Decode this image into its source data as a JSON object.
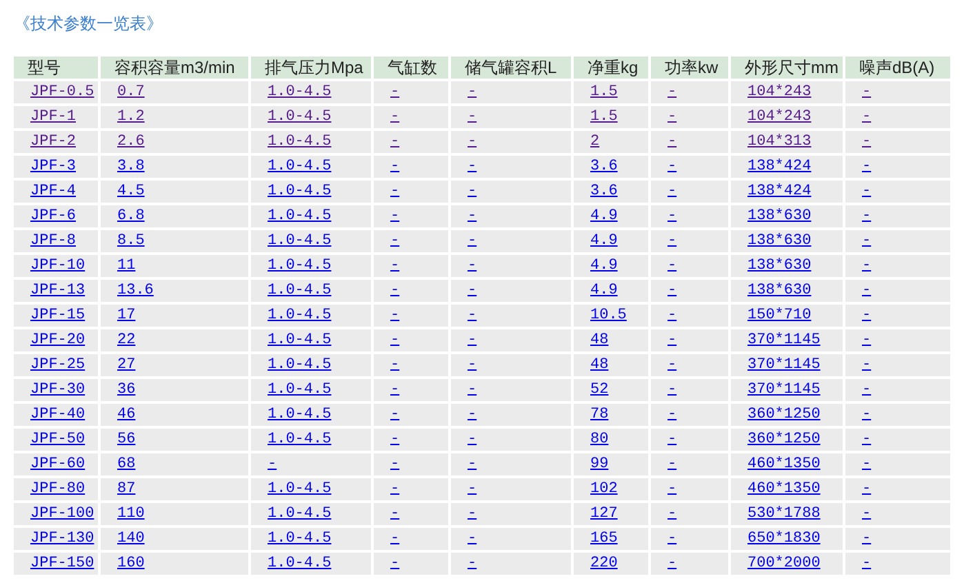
{
  "title": "《技术参数一览表》",
  "table": {
    "columns": [
      "型号",
      "容积容量m3/min",
      "排气压力Mpa",
      "气缸数",
      "储气罐容积L",
      "净重kg",
      "功率kw",
      "外形尺寸mm",
      "噪声dB(A)"
    ],
    "rows": [
      {
        "visited": true,
        "cells": [
          "JPF-0.5",
          "0.7",
          "1.0-4.5",
          "-",
          "-",
          "1.5",
          "-",
          "104*243",
          "-"
        ]
      },
      {
        "visited": true,
        "cells": [
          "JPF-1",
          "1.2",
          "1.0-4.5",
          "-",
          "-",
          "1.5",
          "-",
          "104*243",
          "-"
        ]
      },
      {
        "visited": true,
        "cells": [
          "JPF-2",
          "2.6",
          "1.0-4.5",
          "-",
          "-",
          "2",
          "-",
          "104*313",
          "-"
        ]
      },
      {
        "visited": false,
        "cells": [
          "JPF-3",
          "3.8",
          "1.0-4.5",
          "-",
          "-",
          "3.6",
          "-",
          "138*424",
          "-"
        ]
      },
      {
        "visited": false,
        "cells": [
          "JPF-4",
          "4.5",
          "1.0-4.5",
          "-",
          "-",
          "3.6",
          "-",
          "138*424",
          "-"
        ]
      },
      {
        "visited": false,
        "cells": [
          "JPF-6",
          "6.8",
          "1.0-4.5",
          "-",
          "-",
          "4.9",
          "-",
          "138*630",
          "-"
        ]
      },
      {
        "visited": false,
        "cells": [
          "JPF-8",
          "8.5",
          "1.0-4.5",
          "-",
          "-",
          "4.9",
          "-",
          "138*630",
          "-"
        ]
      },
      {
        "visited": false,
        "cells": [
          "JPF-10",
          "11",
          "1.0-4.5",
          "-",
          "-",
          "4.9",
          "-",
          "138*630",
          "-"
        ]
      },
      {
        "visited": false,
        "cells": [
          "JPF-13",
          "13.6",
          "1.0-4.5",
          "-",
          "-",
          "4.9",
          "-",
          "138*630",
          "-"
        ]
      },
      {
        "visited": false,
        "cells": [
          "JPF-15",
          "17",
          "1.0-4.5",
          "-",
          "-",
          "10.5",
          "-",
          "150*710",
          "-"
        ]
      },
      {
        "visited": false,
        "cells": [
          "JPF-20",
          "22",
          "1.0-4.5",
          "-",
          "-",
          "48",
          "-",
          "370*1145",
          "-"
        ]
      },
      {
        "visited": false,
        "cells": [
          "JPF-25",
          "27",
          "1.0-4.5",
          "-",
          "-",
          "48",
          "-",
          "370*1145",
          "-"
        ]
      },
      {
        "visited": false,
        "cells": [
          "JPF-30",
          "36",
          "1.0-4.5",
          "-",
          "-",
          "52",
          "-",
          "370*1145",
          "-"
        ]
      },
      {
        "visited": false,
        "cells": [
          "JPF-40",
          "46",
          "1.0-4.5",
          "-",
          "-",
          "78",
          "-",
          "360*1250",
          "-"
        ]
      },
      {
        "visited": false,
        "cells": [
          "JPF-50",
          "56",
          "1.0-4.5",
          "-",
          "-",
          "80",
          "-",
          "360*1250",
          "-"
        ]
      },
      {
        "visited": false,
        "cells": [
          "JPF-60",
          "68",
          "-",
          "-",
          "-",
          "99",
          "-",
          "460*1350",
          "-"
        ]
      },
      {
        "visited": false,
        "cells": [
          "JPF-80",
          "87",
          "1.0-4.5",
          "-",
          "-",
          "102",
          "-",
          "460*1350",
          "-"
        ]
      },
      {
        "visited": false,
        "cells": [
          "JPF-100",
          "110",
          "1.0-4.5",
          "-",
          "-",
          "127",
          "-",
          "530*1788",
          "-"
        ]
      },
      {
        "visited": false,
        "cells": [
          "JPF-130",
          "140",
          "1.0-4.5",
          "-",
          "-",
          "165",
          "-",
          "650*1830",
          "-"
        ]
      },
      {
        "visited": false,
        "cells": [
          "JPF-150",
          "160",
          "1.0-4.5",
          "-",
          "-",
          "220",
          "-",
          "700*2000",
          "-"
        ]
      }
    ]
  }
}
